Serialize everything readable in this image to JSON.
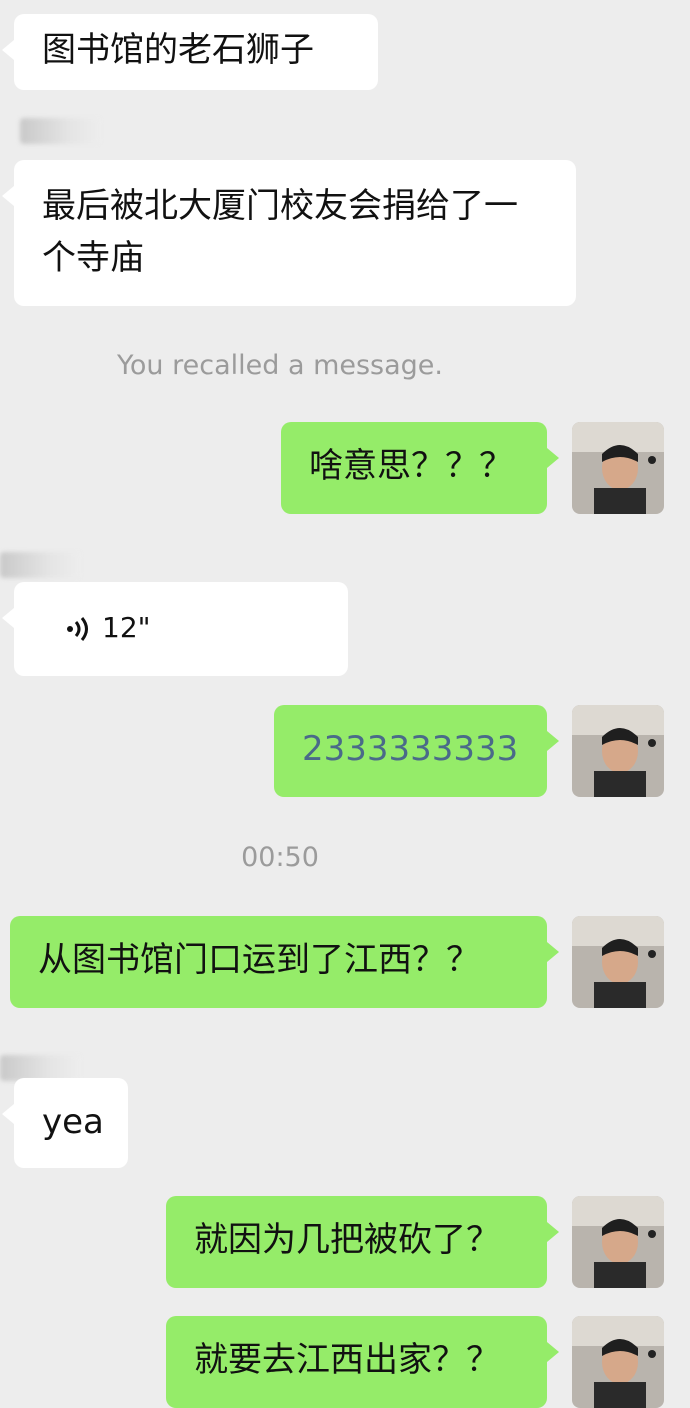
{
  "conversation": {
    "messages": [
      {
        "text": "图书馆的老石狮子"
      },
      {
        "text": "最后被北大厦门校友会捐给了一个寺庙"
      },
      {
        "text": "啥意思？？？"
      },
      {
        "voice_length": "12\""
      },
      {
        "text": "2333333333"
      },
      {
        "text": "从图书馆门口运到了江西？？"
      },
      {
        "text": "yea"
      },
      {
        "text": "就因为几把被砍了？"
      },
      {
        "text": "就要去江西出家？？"
      }
    ],
    "system": {
      "recalled": "You recalled a message.",
      "timestamp": "00:50"
    }
  },
  "icons": {
    "voice": "voice-wave-icon",
    "avatar": "user-avatar"
  },
  "colors": {
    "background": "#ededed",
    "incoming_bubble": "#ffffff",
    "outgoing_bubble": "#95ec69",
    "system_text": "#9b9b9b"
  }
}
